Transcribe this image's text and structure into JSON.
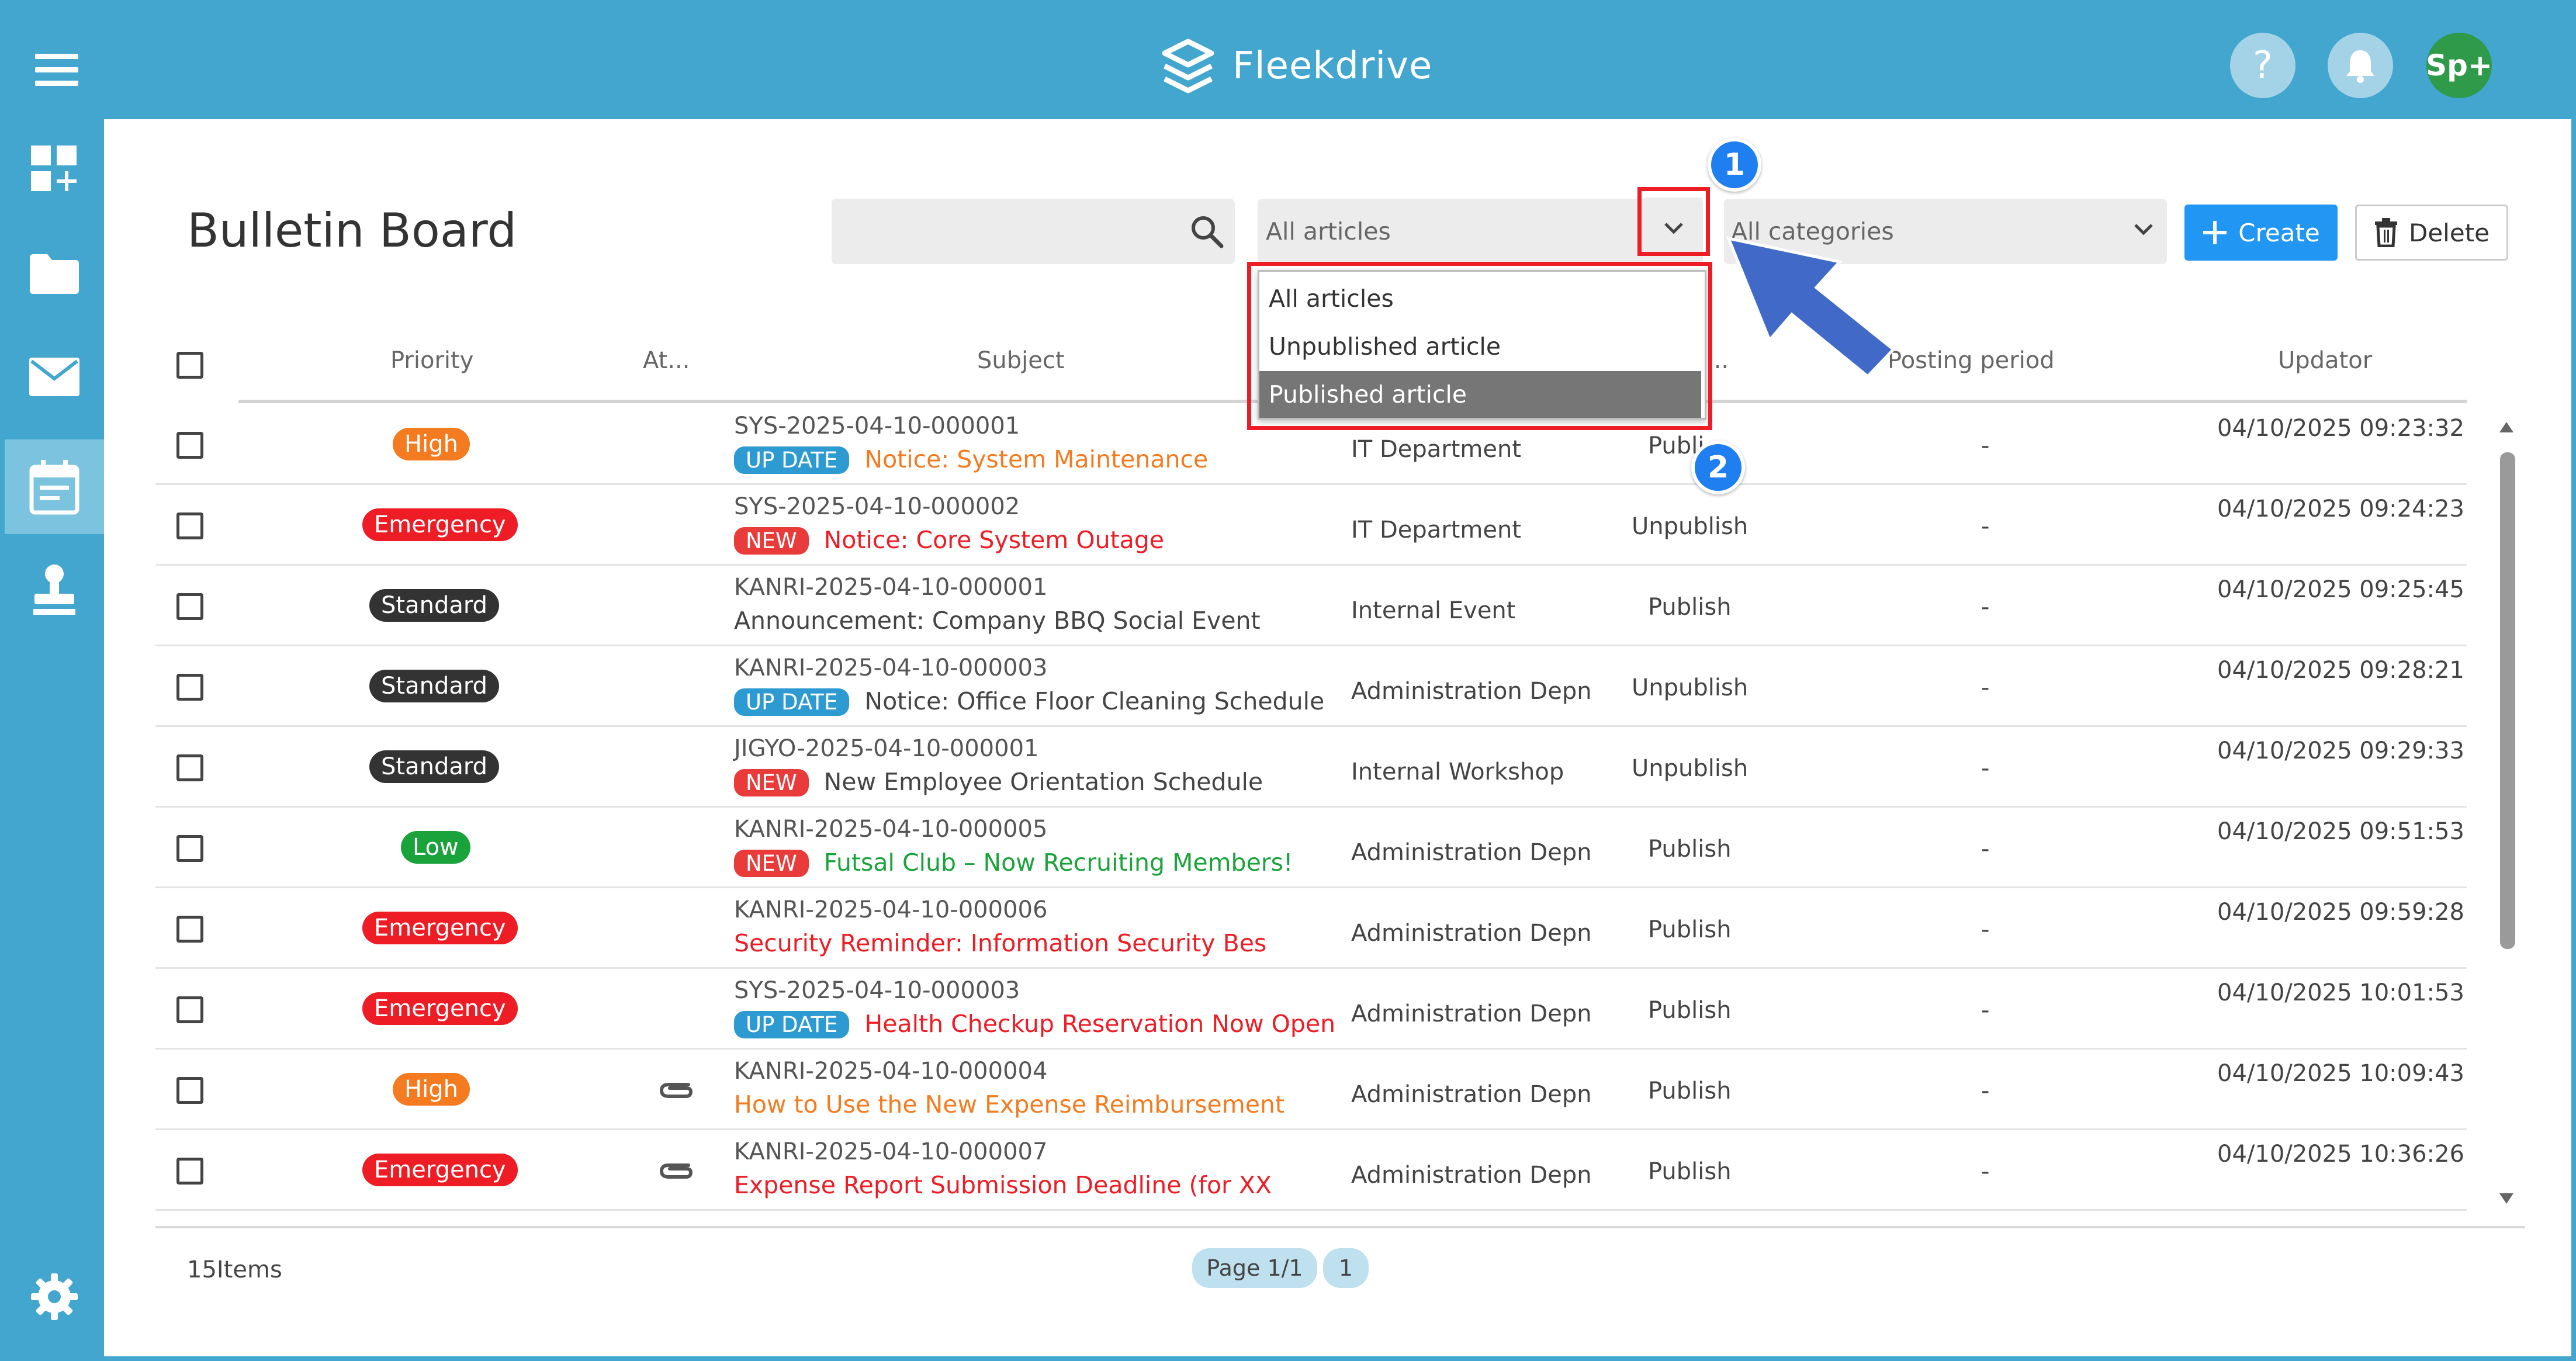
{
  "app": {
    "name": "Fleekdrive",
    "help_label": "?",
    "user_initials": "Sp+"
  },
  "page": {
    "title": "Bulletin Board"
  },
  "toolbar": {
    "search": {
      "value": "",
      "placeholder": ""
    },
    "article_filter": {
      "selected": "All articles",
      "options": [
        "All articles",
        "Unpublished article",
        "Published article"
      ],
      "highlighted": "Published article"
    },
    "category_filter": {
      "selected": "All categories"
    },
    "create_label": "Create",
    "delete_label": "Delete"
  },
  "annotations": {
    "callout_1": "1",
    "callout_2": "2"
  },
  "table": {
    "headers": {
      "priority": "Priority",
      "attachment": "At...",
      "subject": "Subject",
      "category": "",
      "status": "...",
      "posting_period": "Posting period",
      "updator": "Updator"
    },
    "rows": [
      {
        "priority": "High",
        "priority_color": "#f47b20",
        "attachment": false,
        "id": "SYS-2025-04-10-000001",
        "tag": "UP DATE",
        "subject": "Notice: System Maintenance",
        "subject_color": "#f47b20",
        "category": "IT Department",
        "status": "Publi",
        "period": "-",
        "updated": "04/10/2025 09:23:32"
      },
      {
        "priority": "Emergency",
        "priority_color": "#ee1c24",
        "attachment": false,
        "id": "SYS-2025-04-10-000002",
        "tag": "NEW",
        "subject": "Notice: Core System Outage",
        "subject_color": "#ee1c24",
        "category": "IT Department",
        "status": "Unpublish",
        "period": "-",
        "updated": "04/10/2025 09:24:23"
      },
      {
        "priority": "Standard",
        "priority_color": "#333333",
        "attachment": false,
        "id": "KANRI-2025-04-10-000001",
        "tag": "",
        "subject": "Announcement: Company BBQ Social Event",
        "subject_color": "#444444",
        "category": "Internal Event",
        "status": "Publish",
        "period": "-",
        "updated": "04/10/2025 09:25:45"
      },
      {
        "priority": "Standard",
        "priority_color": "#333333",
        "attachment": false,
        "id": "KANRI-2025-04-10-000003",
        "tag": "UP DATE",
        "subject": "Notice: Office Floor Cleaning Schedule",
        "subject_color": "#444444",
        "category": "Administration Depn",
        "status": "Unpublish",
        "period": "-",
        "updated": "04/10/2025 09:28:21"
      },
      {
        "priority": "Standard",
        "priority_color": "#333333",
        "attachment": false,
        "id": "JIGYO-2025-04-10-000001",
        "tag": "NEW",
        "subject": "New Employee Orientation Schedule",
        "subject_color": "#444444",
        "category": "Internal Workshop",
        "status": "Unpublish",
        "period": "-",
        "updated": "04/10/2025 09:29:33"
      },
      {
        "priority": "Low",
        "priority_color": "#19a33a",
        "attachment": false,
        "id": "KANRI-2025-04-10-000005",
        "tag": "NEW",
        "subject": "Futsal Club – Now Recruiting Members!",
        "subject_color": "#19a33a",
        "category": "Administration Depn",
        "status": "Publish",
        "period": "-",
        "updated": "04/10/2025 09:51:53"
      },
      {
        "priority": "Emergency",
        "priority_color": "#ee1c24",
        "attachment": false,
        "id": "KANRI-2025-04-10-000006",
        "tag": "",
        "subject": "Security Reminder: Information Security Bes",
        "subject_color": "#ee1c24",
        "category": "Administration Depn",
        "status": "Publish",
        "period": "-",
        "updated": "04/10/2025 09:59:28"
      },
      {
        "priority": "Emergency",
        "priority_color": "#ee1c24",
        "attachment": false,
        "id": "SYS-2025-04-10-000003",
        "tag": "UP DATE",
        "subject": "Health Checkup Reservation Now Open",
        "subject_color": "#ee1c24",
        "category": "Administration Depn",
        "status": "Publish",
        "period": "-",
        "updated": "04/10/2025 10:01:53"
      },
      {
        "priority": "High",
        "priority_color": "#f47b20",
        "attachment": true,
        "id": "KANRI-2025-04-10-000004",
        "tag": "",
        "subject": "How to Use the New Expense Reimbursement",
        "subject_color": "#f47b20",
        "category": "Administration Depn",
        "status": "Publish",
        "period": "-",
        "updated": "04/10/2025 10:09:43"
      },
      {
        "priority": "Emergency",
        "priority_color": "#ee1c24",
        "attachment": true,
        "id": "KANRI-2025-04-10-000007",
        "tag": "",
        "subject": "Expense Report Submission Deadline (for XX",
        "subject_color": "#ee1c24",
        "category": "Administration Depn",
        "status": "Publish",
        "period": "-",
        "updated": "04/10/2025 10:36:26"
      }
    ]
  },
  "footer": {
    "item_count": "15Items",
    "page_label": "Page 1/1",
    "page_number": "1"
  }
}
